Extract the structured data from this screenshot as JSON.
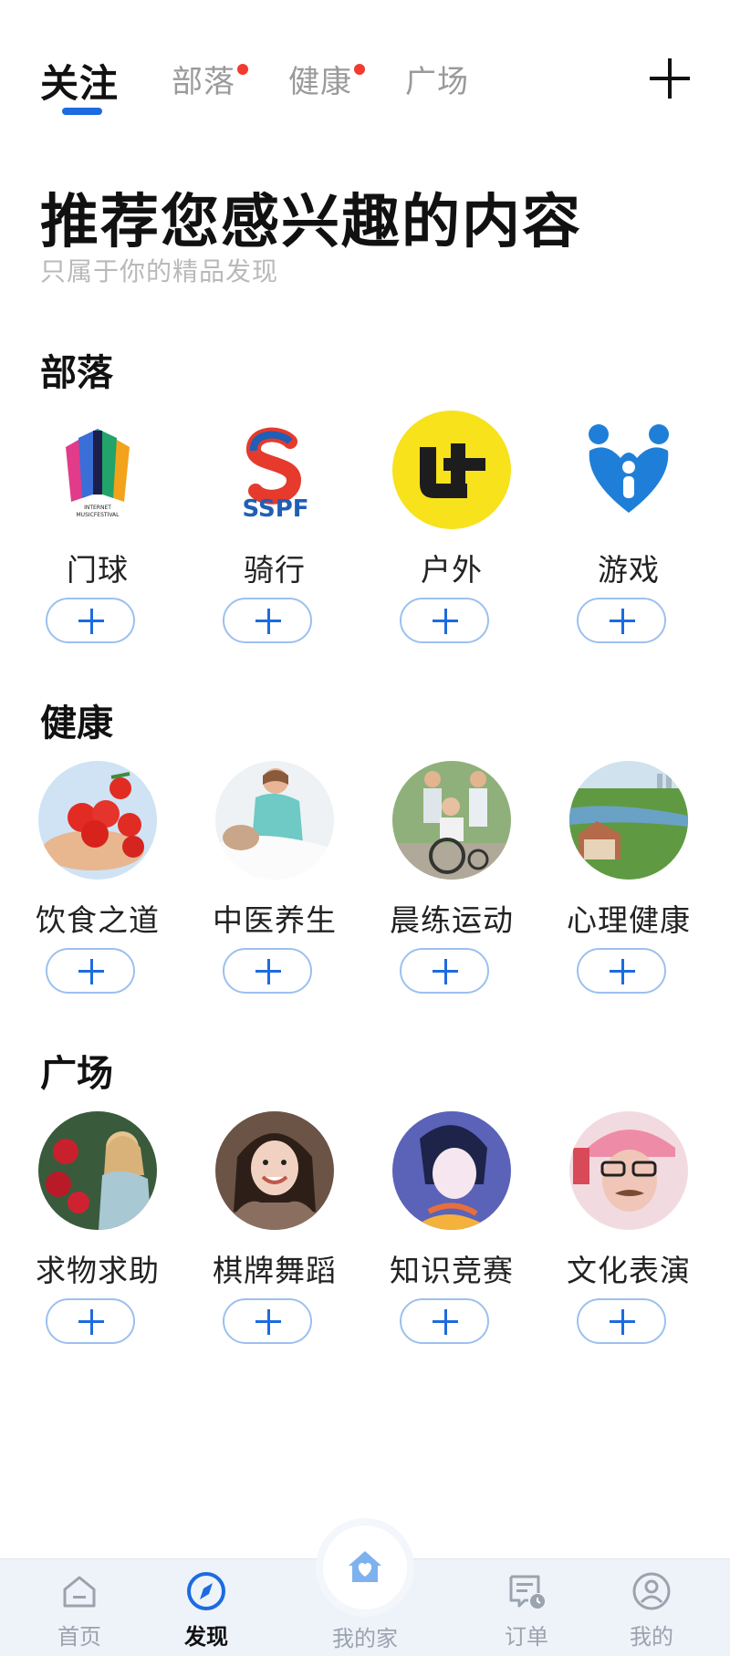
{
  "tabs": [
    {
      "label": "关注",
      "active": true,
      "dot": false
    },
    {
      "label": "部落",
      "active": false,
      "dot": true
    },
    {
      "label": "健康",
      "active": false,
      "dot": true
    },
    {
      "label": "广场",
      "active": false,
      "dot": false
    }
  ],
  "header": {
    "title": "推荐您感兴趣的内容",
    "subtitle": "只属于你的精品发现"
  },
  "sections": [
    {
      "title": "部落",
      "items": [
        {
          "label": "门球",
          "icon": "music-festival-logo"
        },
        {
          "label": "骑行",
          "icon": "sspf-logo"
        },
        {
          "label": "户外",
          "icon": "ut-yellow-logo"
        },
        {
          "label": "游戏",
          "icon": "family-heart-logo"
        }
      ]
    },
    {
      "title": "健康",
      "items": [
        {
          "label": "饮食之道",
          "icon": "tomatoes-photo"
        },
        {
          "label": "中医养生",
          "icon": "nurse-photo"
        },
        {
          "label": "晨练运动",
          "icon": "elderly-wheelchair-photo"
        },
        {
          "label": "心理健康",
          "icon": "landscape-photo"
        }
      ]
    },
    {
      "title": "广场",
      "items": [
        {
          "label": "求物求助",
          "icon": "girl-roses-photo"
        },
        {
          "label": "棋牌舞蹈",
          "icon": "girl-smiling-photo"
        },
        {
          "label": "知识竞赛",
          "icon": "anime-boy-photo"
        },
        {
          "label": "文化表演",
          "icon": "man-pink-cap-photo"
        }
      ]
    }
  ],
  "bottom_nav": [
    {
      "label": "首页",
      "icon": "home-outline-icon",
      "active": false
    },
    {
      "label": "发现",
      "icon": "compass-icon",
      "active": true
    },
    {
      "label": "我的家",
      "icon": "house-heart-icon",
      "active": false
    },
    {
      "label": "订单",
      "icon": "order-icon",
      "active": false
    },
    {
      "label": "我的",
      "icon": "profile-icon",
      "active": false
    }
  ],
  "colors": {
    "accent": "#1c6be0",
    "dot": "#f23b2f",
    "muted": "#9aa3ae",
    "bottom_bar": "#eef3fa",
    "follow_border": "#9cc0ef"
  }
}
